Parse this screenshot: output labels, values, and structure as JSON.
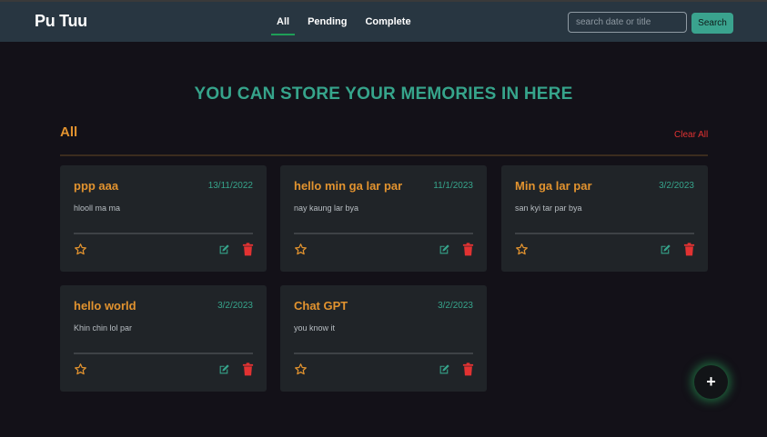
{
  "app": {
    "brand": "Pu Tuu"
  },
  "nav": {
    "tabs": [
      {
        "label": "All",
        "active": true
      },
      {
        "label": "Pending",
        "active": false
      },
      {
        "label": "Complete",
        "active": false
      }
    ]
  },
  "search": {
    "placeholder": "search date or title",
    "value": "",
    "button_label": "Search"
  },
  "hero": {
    "heading": "YOU CAN STORE YOUR MEMORIES IN HERE"
  },
  "section": {
    "title": "All",
    "clear_label": "Clear All"
  },
  "cards": [
    {
      "title": "ppp aaa",
      "date": "13/11/2022",
      "description": "hlooll ma ma",
      "starred": false
    },
    {
      "title": "hello min ga lar par",
      "date": "11/1/2023",
      "description": "nay kaung lar bya",
      "starred": false
    },
    {
      "title": "Min ga lar par",
      "date": "3/2/2023",
      "description": "san kyi tar par bya",
      "starred": false
    },
    {
      "title": "hello world",
      "date": "3/2/2023",
      "description": "Khin chin lol par",
      "starred": false
    },
    {
      "title": "Chat GPT",
      "date": "3/2/2023",
      "description": "you know it",
      "starred": false
    }
  ],
  "icons": {
    "star": "star-icon",
    "edit": "edit-icon",
    "delete": "trash-icon",
    "add": "plus-icon"
  },
  "fab": {
    "label": "+"
  },
  "colors": {
    "background": "#131118",
    "navbar": "#283641",
    "accent_teal": "#36a48b",
    "accent_orange": "#e2932f",
    "danger_red": "#e23232",
    "card_bg": "#202428",
    "active_underline": "#1e9e57"
  }
}
